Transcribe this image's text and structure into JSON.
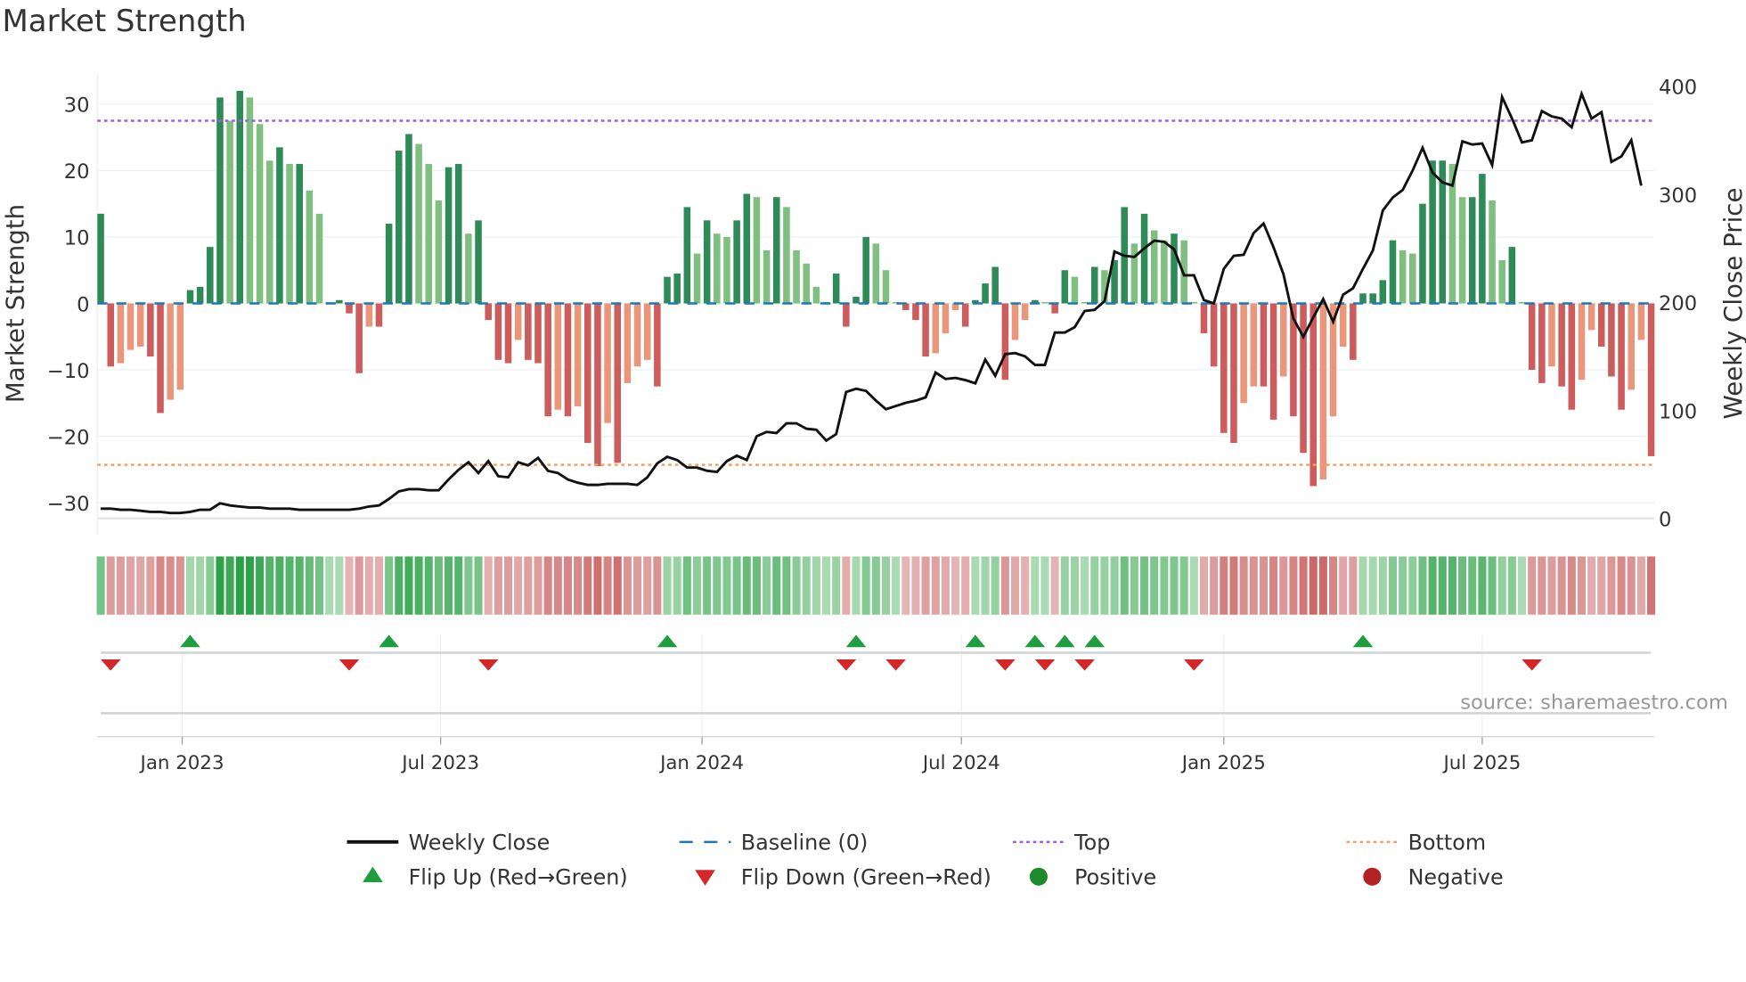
{
  "title": "Market Strength",
  "source": "source: sharemaestro.com",
  "chart_data": {
    "type": "bar",
    "title": "Market Strength",
    "ylabel": "Market Strength",
    "y2label": "Weekly Close Price",
    "ylim": [
      -32,
      35
    ],
    "y2lim": [
      0,
      400
    ],
    "yticks": [
      "30",
      "20",
      "10",
      "0",
      "−10",
      "−20",
      "−30"
    ],
    "ytick_values": [
      30,
      20,
      10,
      0,
      -10,
      -20,
      -30
    ],
    "y2ticks": [
      "400",
      "300",
      "200",
      "100",
      "0"
    ],
    "y2tick_values": [
      400,
      300,
      200,
      100,
      0
    ],
    "xticks": [
      "Jan 2023",
      "Jul 2023",
      "Jan 2024",
      "Jul 2024",
      "Jan 2025",
      "Jul 2025"
    ],
    "xtick_week_index": [
      8.2,
      34.2,
      60.5,
      86.6,
      113,
      139
    ],
    "top_level": 27.5,
    "bottom_level": -24.3,
    "grid": true,
    "strength": [
      13.5,
      -9.5,
      -9,
      -7,
      -6.5,
      -8,
      -16.5,
      -14.5,
      -13,
      2,
      2.5,
      8.5,
      31,
      27.5,
      32,
      31,
      27,
      21.5,
      23.5,
      21,
      21,
      17,
      13.5,
      0.2,
      0.5,
      -1.5,
      -10.5,
      -3.5,
      -3.5,
      12,
      23,
      25.5,
      24,
      21,
      15.5,
      20.5,
      21,
      10.5,
      12.5,
      -2.5,
      -8.5,
      -9,
      -5.5,
      -8.5,
      -9,
      -17,
      -16,
      -17,
      -15.5,
      -21,
      -24.5,
      -18,
      -24,
      -12,
      -9.5,
      -8.5,
      -12.5,
      4,
      4.5,
      14.5,
      7.5,
      12.5,
      10.5,
      10,
      12.5,
      16.5,
      16,
      8,
      16,
      14.5,
      8,
      6,
      2.5,
      0.2,
      4.5,
      -3.5,
      1,
      10,
      9,
      5,
      0.2,
      -1,
      -2.5,
      -8,
      -7.5,
      -4.5,
      -1,
      -3.5,
      0.5,
      3,
      5.5,
      -11.5,
      -5.5,
      -2.5,
      0.5,
      0.2,
      -1.5,
      5,
      4,
      0.2,
      5.5,
      5,
      6.5,
      14.5,
      9,
      13.5,
      11,
      9.5,
      10.5,
      9.5,
      0.2,
      -4.5,
      -9.5,
      -19.5,
      -21,
      -15,
      -12.5,
      -12.5,
      -17.5,
      -11,
      -17,
      -22.5,
      -27.5,
      -26.5,
      -17,
      -6.5,
      -8.5,
      1.5,
      1.5,
      3.5,
      9.5,
      8,
      7.5,
      15,
      21.5,
      21.5,
      21,
      16,
      16,
      19.5,
      15.5,
      6.5,
      8.5,
      0.2,
      -10,
      -12,
      -9.5,
      -12.5,
      -16,
      -11.5,
      -4,
      -6.5,
      -11,
      -16,
      -13,
      -5.5,
      -23
    ],
    "weekly_close": [
      9,
      9,
      8,
      8,
      7,
      6,
      6,
      5,
      5,
      6,
      8,
      8,
      14,
      12,
      11,
      10,
      10,
      9,
      9,
      9,
      8,
      8,
      8,
      8,
      8,
      8,
      9,
      11,
      12,
      18,
      25,
      27,
      27,
      26,
      26,
      36,
      45,
      52,
      42,
      53,
      39,
      38,
      52,
      49,
      56,
      44,
      42,
      36,
      33,
      31,
      31,
      32,
      32,
      32,
      31,
      38,
      51,
      57,
      54,
      47,
      47,
      44,
      43,
      53,
      58,
      54,
      76,
      80,
      79,
      88,
      88,
      83,
      82,
      72,
      78,
      117,
      120,
      118,
      109,
      101,
      104,
      107,
      109,
      112,
      135,
      129,
      130,
      128,
      125,
      147,
      132,
      152,
      153,
      150,
      142,
      142,
      172,
      172,
      177,
      192,
      193,
      201,
      247,
      243,
      242,
      250,
      257,
      256,
      249,
      225,
      225,
      202,
      199,
      231,
      243,
      244,
      264,
      273,
      251,
      226,
      185,
      168,
      186,
      203,
      182,
      207,
      213,
      231,
      248,
      285,
      297,
      304,
      322,
      343,
      320,
      311,
      308,
      349,
      346,
      347,
      327,
      390,
      370,
      348,
      350,
      377,
      372,
      370,
      362,
      393,
      370,
      376,
      330,
      335,
      350,
      308
    ],
    "flip_up_week_index": [
      9,
      29,
      57,
      76,
      88,
      94,
      97,
      100,
      127
    ],
    "flip_down_week_index": [
      1,
      25,
      39,
      75,
      80,
      91,
      95,
      99,
      110,
      144
    ],
    "colors": {
      "up_strong": "#2e8b57",
      "up_weak": "#7fbf7f",
      "down_strong": "#cd5c5c",
      "down_weak": "#e9967a",
      "close": "#111111",
      "baseline": "#1f77b4",
      "top": "#9b5de5",
      "bottom": "#f4a261",
      "flip_up": "#1e9e3e",
      "flip_down": "#d62728",
      "positive": "#1e8a2e",
      "negative": "#b22222"
    },
    "legend": [
      {
        "label": "Weekly Close",
        "kind": "line",
        "color": "#111111"
      },
      {
        "label": "Baseline (0)",
        "kind": "dash",
        "color": "#1f77b4"
      },
      {
        "label": "Top",
        "kind": "dot",
        "color": "#9b5de5"
      },
      {
        "label": "Bottom",
        "kind": "dot",
        "color": "#f4a261"
      },
      {
        "label": "Flip Up (Red→Green)",
        "kind": "tri-up",
        "color": "#1e9e3e"
      },
      {
        "label": "Flip Down (Green→Red)",
        "kind": "tri-down",
        "color": "#d62728"
      },
      {
        "label": "Positive",
        "kind": "circle",
        "color": "#1e8a2e"
      },
      {
        "label": "Negative",
        "kind": "circle",
        "color": "#b22222"
      }
    ],
    "legend_placement": "bottom"
  }
}
